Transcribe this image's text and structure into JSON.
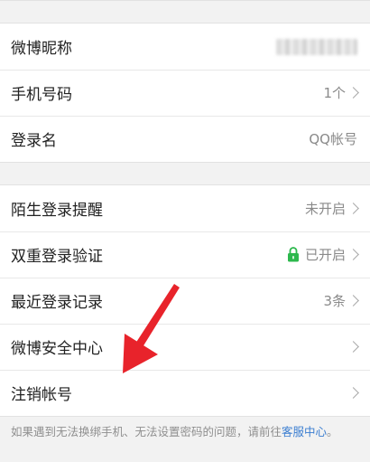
{
  "group1": [
    {
      "label": "微博昵称",
      "value": ""
    },
    {
      "label": "手机号码",
      "value": "1个"
    },
    {
      "label": "登录名",
      "value": "QQ帐号"
    }
  ],
  "group2": [
    {
      "label": "陌生登录提醒",
      "value": "未开启"
    },
    {
      "label": "双重登录验证",
      "value": "已开启"
    },
    {
      "label": "最近登录记录",
      "value": "3条"
    },
    {
      "label": "微博安全中心",
      "value": ""
    },
    {
      "label": "注销帐号",
      "value": ""
    }
  ],
  "footer": {
    "text": "如果遇到无法换绑手机、无法设置密码的问题，请前往",
    "link": "客服中心",
    "end": "。"
  },
  "colors": {
    "lock": "#2db84d",
    "annotation_arrow": "#e8232b",
    "link": "#3a7dd0"
  }
}
